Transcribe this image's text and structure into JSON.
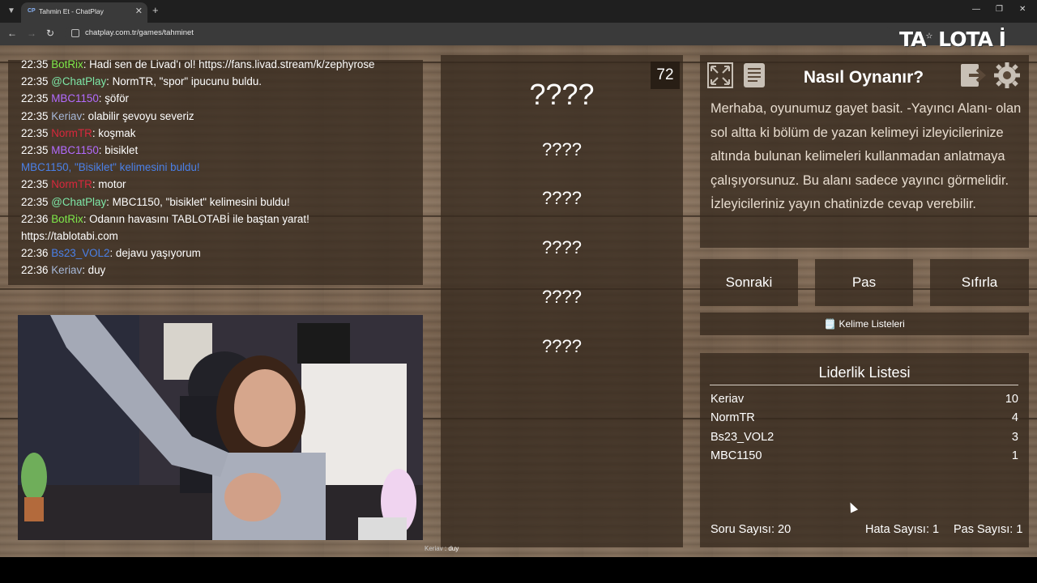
{
  "browser": {
    "tab_title": "Tahmin Et - ChatPlay",
    "tab_favicon": "CP",
    "url": "chatplay.com.tr/games/tahminet",
    "extension_logo": "TA",
    "extension_logo2": "LOTA",
    "extension_logo3": "İ"
  },
  "chat": {
    "lines": [
      {
        "time": "22:35",
        "user": "BotRix",
        "user_color": "#7ee84a",
        "text": ": Hadi sen de Livad'ı ol! https://fans.livad.stream/k/zephyrose"
      },
      {
        "time": "22:35",
        "user": "@ChatPlay",
        "user_color": "#7ee8a8",
        "text": ": NormTR, \"spor\" ipucunu buldu."
      },
      {
        "time": "22:35",
        "user": "MBC1150",
        "user_color": "#b36bff",
        "text": ": şöför"
      },
      {
        "time": "22:35",
        "user": "Keriav",
        "user_color": "#a6b8d8",
        "text": ": olabilir şevoyu severiz"
      },
      {
        "time": "22:35",
        "user": "NormTR",
        "user_color": "#d8283c",
        "text": ": koşmak"
      },
      {
        "time": "22:35",
        "user": "MBC1150",
        "user_color": "#b36bff",
        "text": ": bisiklet"
      },
      {
        "time": "",
        "user": "",
        "user_color": "#4a80e8",
        "text": "MBC1150, \"Bisiklet\" kelimesini buldu!",
        "system": true
      },
      {
        "time": "22:35",
        "user": "NormTR",
        "user_color": "#d8283c",
        "text": ": motor"
      },
      {
        "time": "22:35",
        "user": "@ChatPlay",
        "user_color": "#7ee8a8",
        "text": ": MBC1150, \"bisiklet\" kelimesini buldu!"
      },
      {
        "time": "22:36",
        "user": "BotRix",
        "user_color": "#7ee84a",
        "text": ": Odanın havasını TABLOTABİ ile baştan yarat!"
      },
      {
        "time": "",
        "user": "",
        "user_color": "#ffffff",
        "text": "https://tablotabi.com"
      },
      {
        "time": "22:36",
        "user": "Bs23_VOL2",
        "user_color": "#4a80e8",
        "text": ": dejavu yaşıyorum"
      },
      {
        "time": "22:36",
        "user": "Keriav",
        "user_color": "#a6b8d8",
        "text": ": duy"
      }
    ]
  },
  "game": {
    "timer": "72",
    "words": [
      "????",
      "????",
      "????",
      "????",
      "????",
      "????"
    ]
  },
  "howto": {
    "title": "Nasıl Oynanır?",
    "text": "Merhaba, oyunumuz gayet basit. -Yayıncı Alanı- olan sol altta ki bölüm de yazan kelimeyi izleyicilerinize altında bulunan kelimeleri kullanmadan anlatmaya çalışıyorsunuz. Bu alanı sadece yayıncı görmelidir. İzleyicileriniz yayın chatinizde cevap verebilir."
  },
  "controls": {
    "next": "Sonraki",
    "pass": "Pas",
    "reset": "Sıfırla",
    "word_lists": "Kelime Listeleri"
  },
  "leaderboard": {
    "title": "Liderlik Listesi",
    "rows": [
      {
        "name": "Keriav",
        "score": "10"
      },
      {
        "name": "NormTR",
        "score": "4"
      },
      {
        "name": "Bs23_VOL2",
        "score": "3"
      },
      {
        "name": "MBC1150",
        "score": "1"
      }
    ],
    "questions": "Soru Sayısı: 20",
    "errors": "Hata Sayısı: 1",
    "passes": "Pas Sayısı: 1"
  },
  "caption": {
    "user": "Keriav",
    "text": " : duy"
  },
  "colors": {
    "panel": "#372a1f",
    "wood": "#7a6551"
  }
}
